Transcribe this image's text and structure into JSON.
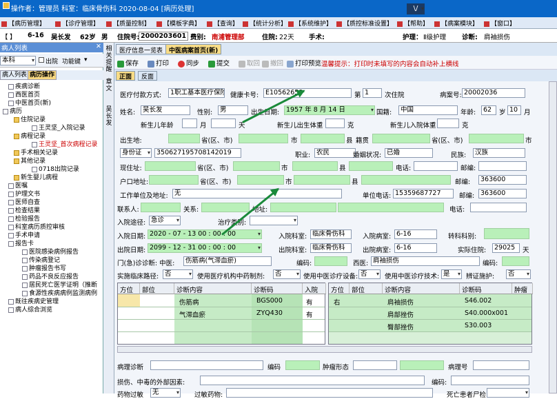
{
  "titlebar": {
    "text": "操作者：管理员  科室：临床骨伤科  2020-08-04  [病历处理]",
    "dropdown": "\\/"
  },
  "menu": [
    "【病历管理】",
    "【诊疗管理】",
    "【质量控制】",
    "【模板字典】",
    "【查询】",
    "【统计分析】",
    "【系统维护】",
    "【质控标准设置】",
    "【帮助】",
    "【病案模块】",
    "【窗口】"
  ],
  "patient": {
    "bed": "6-16",
    "name": "吴长发",
    "age": "62岁",
    "sex": "男",
    "inpatient_label": "住院号:",
    "inpatient_no": "2000203601",
    "category_label": "费别:",
    "category": "南浦管理部",
    "admit_label": "住院:",
    "admit_days": "22天",
    "surgery_label": "手术:",
    "nursing_label": "护理：",
    "nursing": "Ⅱ级护理",
    "diagnosis_label": "诊断:",
    "diagnosis": "肩袖损伤"
  },
  "left_panel": {
    "title": "病人列表",
    "dept": "本科",
    "discharge": "出院",
    "func": "功能键",
    "tabs": [
      "病人列表",
      "病历操作"
    ],
    "tree": [
      "疾病诊断",
      "西医首页",
      "中医首页(新)",
      "病历",
      "住院记录",
      "王灵坚_入院记录",
      "病程记录",
      "王灵坚_首次病程记录",
      "手术相关记录",
      "其他记录",
      "0718出院记录",
      "新生婴儿病程",
      "医嘱",
      "护理文书",
      "医师自查",
      "检查结果",
      "检验报告",
      "科室病历质控审核",
      "手术申请",
      "报告卡",
      "医院感染病例报告",
      "传染病登记",
      "肿瘤报告书写",
      "药品不良反应报告",
      "居民死亡医学证明（推断",
      "食源性疾病病例监测病例",
      "既往疾病史管理",
      "病人综合浏览"
    ]
  },
  "vtabs": [
    "相关提醒",
    "章文",
    "吴长发"
  ],
  "tabs": [
    "医疗信息一览表",
    "中医病案首页(新)"
  ],
  "toolbar": {
    "save": "保存",
    "print": "打印",
    "sync": "同步",
    "submit": "提交",
    "return": "取回",
    "back": "撤回",
    "preview": "打印预览",
    "tip": "温馨提示：打印时未填写的内容会自动补上横线"
  },
  "subtabs": [
    "正面",
    "反面"
  ],
  "form": {
    "pay_label": "医疗付款方式:",
    "pay": "1职工基本医疗保险",
    "card_label": "健康卡号:",
    "card": "E10562658",
    "times_label": "第",
    "times": "1",
    "times_unit": "次住院",
    "case_label": "病案号:",
    "case": "20002036",
    "name_label": "姓名:",
    "name": "吴长发",
    "sex_label": "性别:",
    "sex": "男",
    "birth_label": "出生日期:",
    "birth": "1957 年 8 月 14 日",
    "nation_label": "国籍:",
    "nation": "中国",
    "age_label": "年龄:",
    "age": "62",
    "age_unit": "岁",
    "age_month": "10",
    "month_unit": "月",
    "baby_age_label": "新生儿年龄",
    "month": "月",
    "day": "天",
    "baby_weight_label": "新生儿出生体重",
    "gram": "克",
    "baby_in_label": "新生儿入院体重",
    "gram2": "克",
    "birthplace_label": "出生地:",
    "prov": "省(区、市)",
    "city": "市",
    "county": "县",
    "native_label": "籍贯",
    "prov2": "省(区、市)",
    "city2": "市",
    "id_type": "身份证",
    "id": "350627195708142019",
    "job_label": "职业:",
    "job": "农民",
    "marital_label": "婚姻状况:",
    "marital": "已婚",
    "ethnic_label": "民族:",
    "ethnic": "汉族",
    "addr_label": "现住址:",
    "prov3": "省(区、市)",
    "city3": "市",
    "county3": "县",
    "phone_label": "电话:",
    "post_label": "邮编:",
    "hukou_label": "户口地址:",
    "prov4": "省(区、市)",
    "city4": "市",
    "county4": "县",
    "post2_label": "邮编:",
    "post2": "363600",
    "work_label": "工作单位及地址:",
    "work": "无",
    "work_phone_label": "单位电话:",
    "work_phone": "15359687727",
    "post3_label": "邮编:",
    "post3": "363600",
    "contact_label": "联系人:",
    "relation_label": "关系:",
    "contact_addr_label": "地址:",
    "contact_phone_label": "电话:",
    "route_label": "入院途径:",
    "route": "急诊",
    "treat_label": "治疗类别:",
    "admit_date_label": "入院日期:",
    "admit_date": "2020 - 07 - 13   00 : 00 : 00",
    "admit_dept_label": "入院科室:",
    "admit_dept": "临床骨伤科",
    "admit_ward_label": "入院病室:",
    "admit_ward": "6-16",
    "transfer_label": "转科科别:",
    "dis_date_label": "出院日期:",
    "dis_date": "2099 - 12 - 31   00 : 00 : 00",
    "dis_dept_label": "出院科室:",
    "dis_dept": "临床骨伤科",
    "dis_ward_label": "出院病室:",
    "dis_ward": "6-16",
    "actual_label": "实际住院:",
    "actual": "29025",
    "actual_unit": "天",
    "clinic_label": "门(急)诊诊断: 中医:",
    "clinic_tcm": "伤筋病(气滞血瘀)",
    "code_label": "编码:",
    "west_label": "西医:",
    "west": "肩袖损伤",
    "code2_label": "编码:",
    "path_label": "实施临床路径:",
    "path": "否",
    "tcm_drug_label": "使用医疗机构中药制剂:",
    "tcm_drug": "否",
    "tcm_equip_label": "使用中医诊疗设备:",
    "tcm_equip": "否",
    "tcm_tech_label": "使用中医诊疗技术:",
    "tcm_tech": "是",
    "syndrome_label": "辨证施护:",
    "syndrome": "否",
    "path_diag_label": "病理诊断",
    "code3_label": "编码",
    "tumor_label": "肿瘤形态",
    "path_no_label": "病理号",
    "injury_label": "损伤、中毒的外部因素:",
    "code4_label": "编码:",
    "allergy_label": "药物过敏",
    "allergy": "无",
    "allergy_drug_label": "过敏药物:",
    "death_label": "死亡患者尸检:"
  },
  "grid_left": {
    "headers": [
      "方位",
      "部位",
      "诊断内容",
      "诊断码",
      "入院"
    ],
    "rows": [
      [
        "",
        "",
        "伤筋病",
        "BGS000",
        "有"
      ],
      [
        "",
        "",
        "气滞血瘀",
        "ZYQ430",
        "有"
      ]
    ]
  },
  "grid_right": {
    "headers": [
      "方位",
      "部位",
      "诊断内容",
      "诊断码",
      "肿瘤"
    ],
    "rows": [
      [
        "右",
        "",
        "肩袖损伤",
        "S46.002",
        ""
      ],
      [
        "",
        "",
        "肩部挫伤",
        "S40.000x001",
        ""
      ],
      [
        "",
        "",
        "臀部挫伤",
        "S30.003",
        ""
      ]
    ]
  }
}
